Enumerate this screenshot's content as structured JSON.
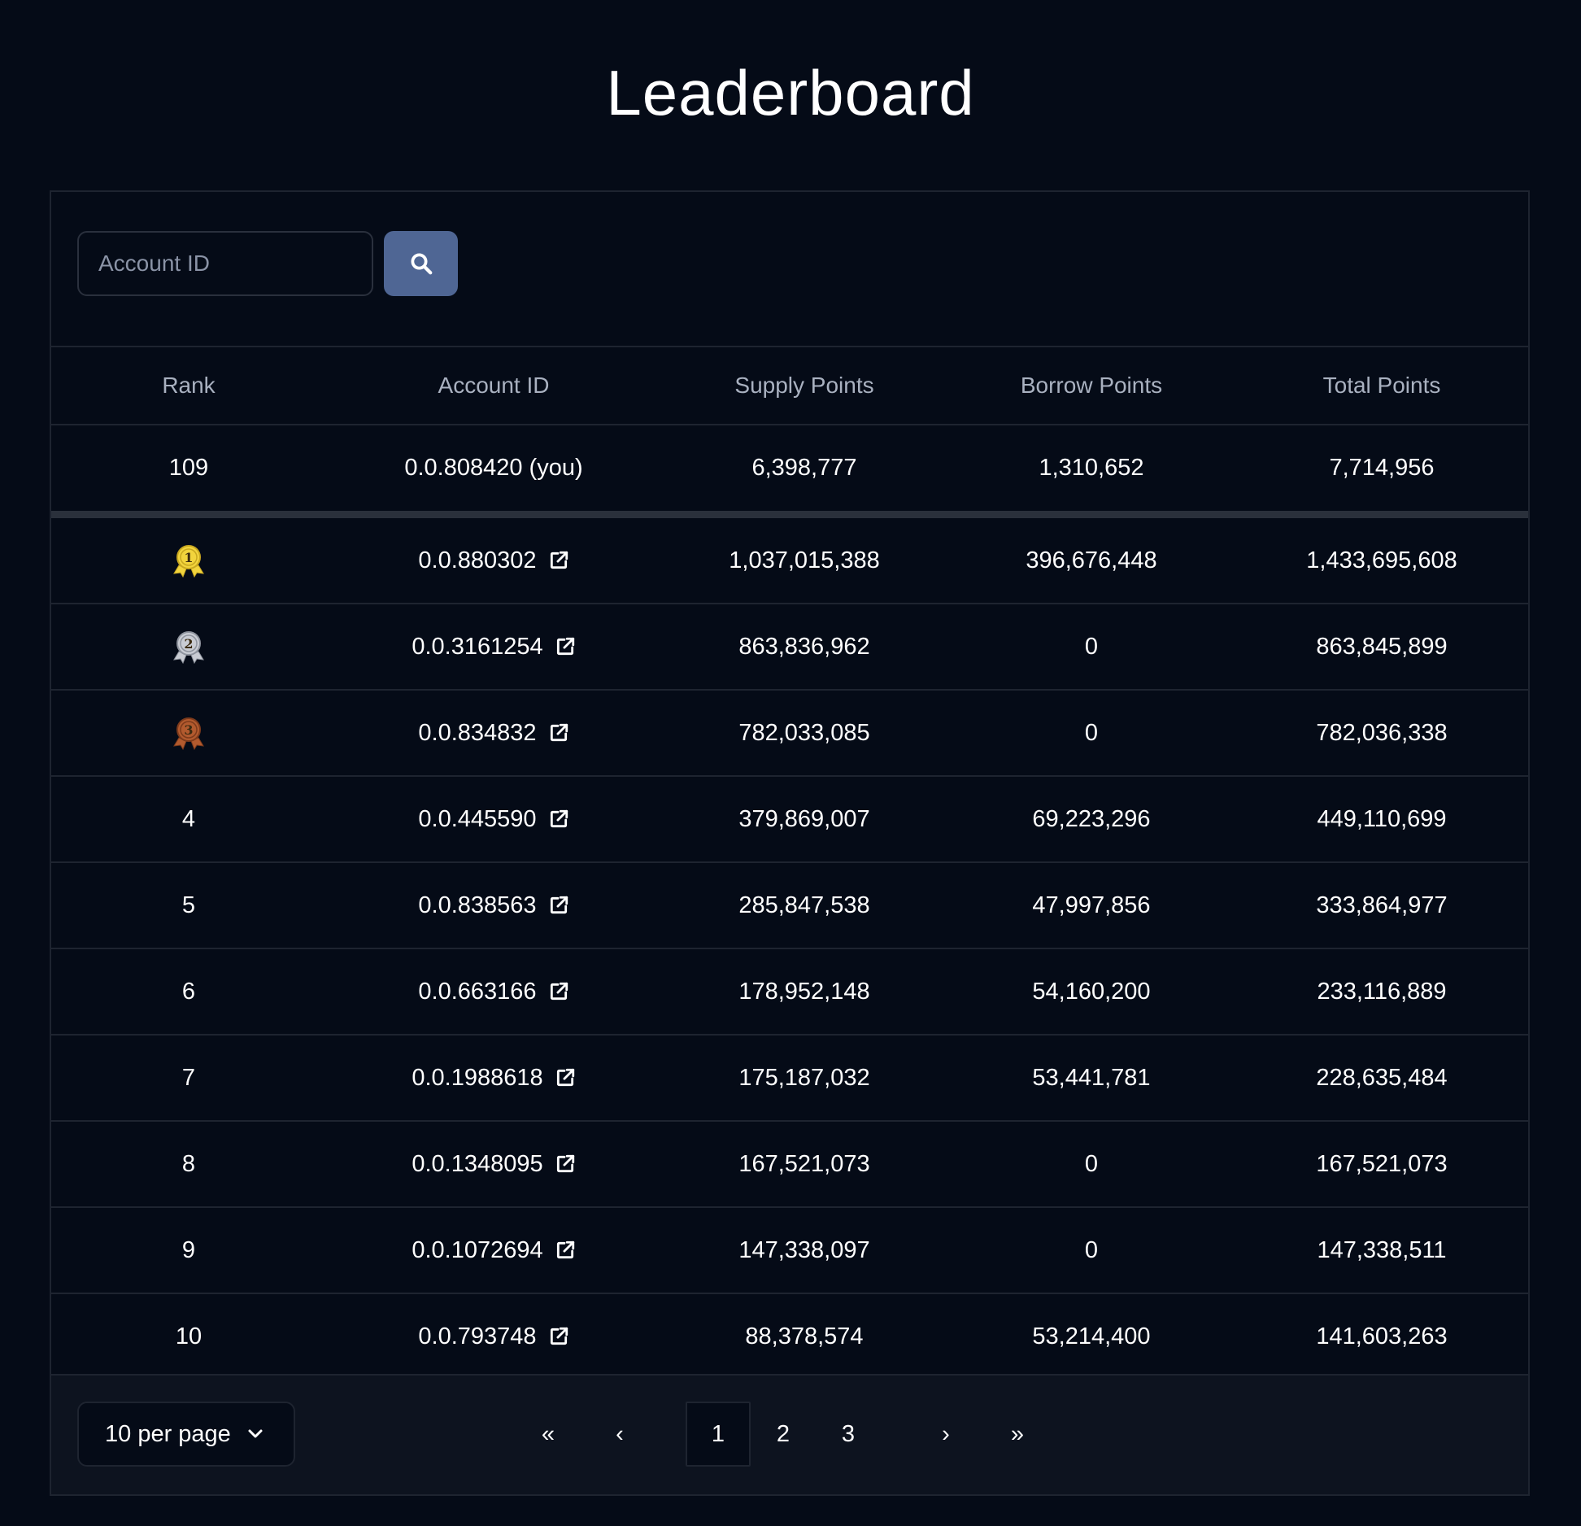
{
  "page": {
    "title": "Leaderboard"
  },
  "search": {
    "placeholder": "Account ID",
    "button_icon": "search-icon"
  },
  "table": {
    "columns": [
      "Rank",
      "Account ID",
      "Supply Points",
      "Borrow Points",
      "Total Points"
    ],
    "you_row": {
      "rank": "109",
      "account_id": "0.0.808420 (you)",
      "supply": "6,398,777",
      "borrow": "1,310,652",
      "total": "7,714,956"
    },
    "rows": [
      {
        "rank": "1",
        "medal": "gold-medal-icon",
        "account_id": "0.0.880302",
        "supply": "1,037,015,388",
        "borrow": "396,676,448",
        "total": "1,433,695,608"
      },
      {
        "rank": "2",
        "medal": "silver-medal-icon",
        "account_id": "0.0.3161254",
        "supply": "863,836,962",
        "borrow": "0",
        "total": "863,845,899"
      },
      {
        "rank": "3",
        "medal": "bronze-medal-icon",
        "account_id": "0.0.834832",
        "supply": "782,033,085",
        "borrow": "0",
        "total": "782,036,338"
      },
      {
        "rank": "4",
        "account_id": "0.0.445590",
        "supply": "379,869,007",
        "borrow": "69,223,296",
        "total": "449,110,699"
      },
      {
        "rank": "5",
        "account_id": "0.0.838563",
        "supply": "285,847,538",
        "borrow": "47,997,856",
        "total": "333,864,977"
      },
      {
        "rank": "6",
        "account_id": "0.0.663166",
        "supply": "178,952,148",
        "borrow": "54,160,200",
        "total": "233,116,889"
      },
      {
        "rank": "7",
        "account_id": "0.0.1988618",
        "supply": "175,187,032",
        "borrow": "53,441,781",
        "total": "228,635,484"
      },
      {
        "rank": "8",
        "account_id": "0.0.1348095",
        "supply": "167,521,073",
        "borrow": "0",
        "total": "167,521,073"
      },
      {
        "rank": "9",
        "account_id": "0.0.1072694",
        "supply": "147,338,097",
        "borrow": "0",
        "total": "147,338,511"
      },
      {
        "rank": "10",
        "account_id": "0.0.793748",
        "supply": "88,378,574",
        "borrow": "53,214,400",
        "total": "141,603,263"
      }
    ]
  },
  "pagination": {
    "per_page_label": "10 per page",
    "first": "«",
    "prev": "‹",
    "pages": [
      "1",
      "2",
      "3"
    ],
    "current_page": "1",
    "next": "›",
    "last": "»"
  },
  "colors": {
    "background": "#050b17",
    "search_button": "#4f6694",
    "footer": "#0d131f",
    "gold": "#f2d43d",
    "silver": "#c9ccd3",
    "bronze": "#b25a2e"
  }
}
